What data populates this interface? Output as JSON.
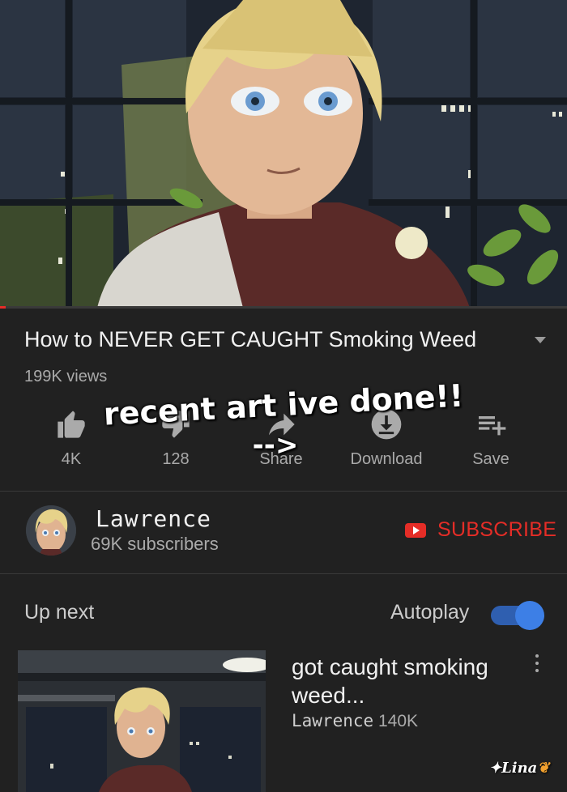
{
  "player": {
    "progress_fraction": 0.01
  },
  "video": {
    "title": "How to NEVER GET CAUGHT Smoking Weed",
    "views": "199K views"
  },
  "actions": {
    "like_count": "4K",
    "dislike_count": "128",
    "share_label": "Share",
    "download_label": "Download",
    "save_label": "Save"
  },
  "overlay": {
    "line1": "recent art ive done!!",
    "line2": "-->"
  },
  "channel": {
    "name": "Lawrence",
    "subscribers": "69K subscribers",
    "subscribe_label": "SUBSCRIBE"
  },
  "up_next": {
    "label": "Up next",
    "autoplay_label": "Autoplay",
    "autoplay_on": true,
    "items": [
      {
        "title": "got caught smoking weed...",
        "channel": "Lawrence",
        "views": "140K"
      }
    ]
  },
  "watermark": {
    "text": "Lina"
  },
  "colors": {
    "background": "#212121",
    "accent_red": "#e52d27",
    "toggle_blue": "#3d7fe6"
  }
}
